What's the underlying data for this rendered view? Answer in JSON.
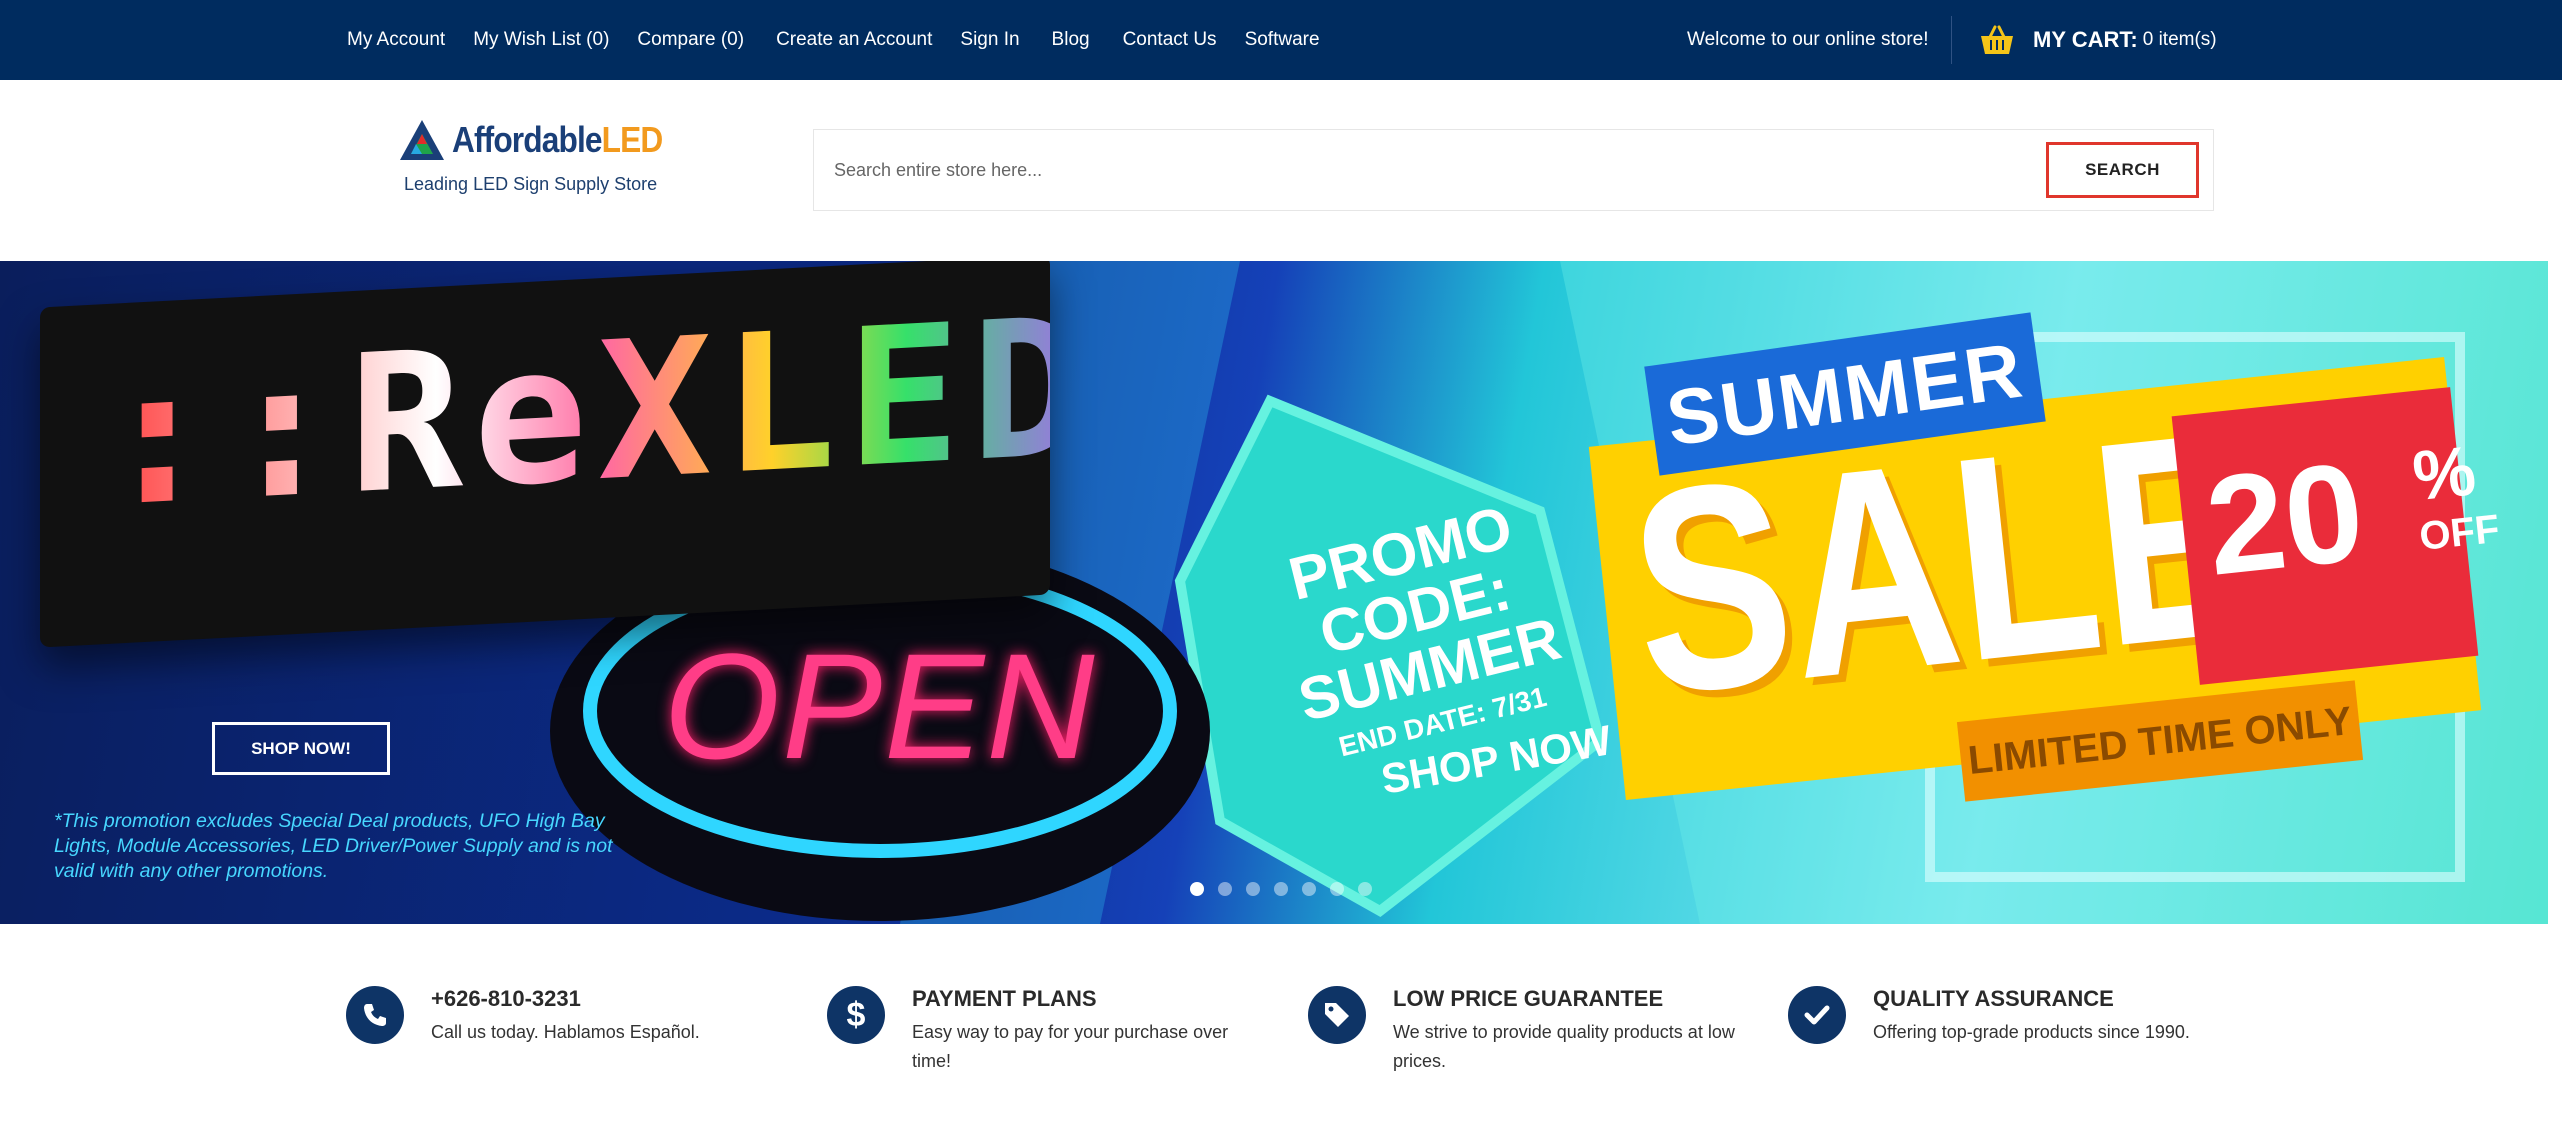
{
  "topbar": {
    "links": [
      "My Account",
      "My Wish List (0)",
      "Compare (0)",
      "Create an Account",
      "Sign In",
      "Blog",
      "Contact Us",
      "Software"
    ],
    "welcome": "Welcome to our online store!",
    "cart_title": "MY CART:",
    "cart_count": "0 item(s)"
  },
  "header": {
    "logo_part1": "Affordable",
    "logo_part2": "LED",
    "tagline": "Leading LED Sign Supply Store",
    "search_placeholder": "Search entire store here...",
    "search_button": "SEARCH"
  },
  "banner": {
    "open_sign": "OPEN",
    "promo_code": "PROMO\nCODE:\nSUMMER",
    "end_date": "END DATE: 7/31",
    "shop_now_graphic": "SHOP NOW",
    "summer": "SUMMER",
    "sale": "SALE!",
    "percent_number": "20",
    "percent_sign": "%",
    "percent_off": "OFF",
    "limited": "LIMITED TIME ONLY",
    "shop_button": "SHOP NOW!",
    "disclaimer": "*This promotion excludes Special Deal products, UFO High Bay Lights, Module Accessories, LED Driver/Power Supply and is not valid with any other promotions.",
    "slide_count": 7,
    "active_slide": 1
  },
  "features": [
    {
      "icon": "phone-icon",
      "title": "+626-810-3231",
      "desc": "Call us today. Hablamos Español."
    },
    {
      "icon": "dollar-icon",
      "title": "PAYMENT PLANS",
      "desc": "Easy way to pay for your purchase over time!"
    },
    {
      "icon": "tag-icon",
      "title": "LOW PRICE GUARANTEE",
      "desc": "We strive to provide quality products at low prices."
    },
    {
      "icon": "check-icon",
      "title": "QUALITY ASSURANCE",
      "desc": "Offering top-grade products since 1990."
    }
  ],
  "colors": {
    "topbar": "#002c5f",
    "accent_red": "#e0362c",
    "icon_bg": "#0e3466",
    "logo_blue": "#1a3f78",
    "logo_orange": "#f29a1e"
  }
}
